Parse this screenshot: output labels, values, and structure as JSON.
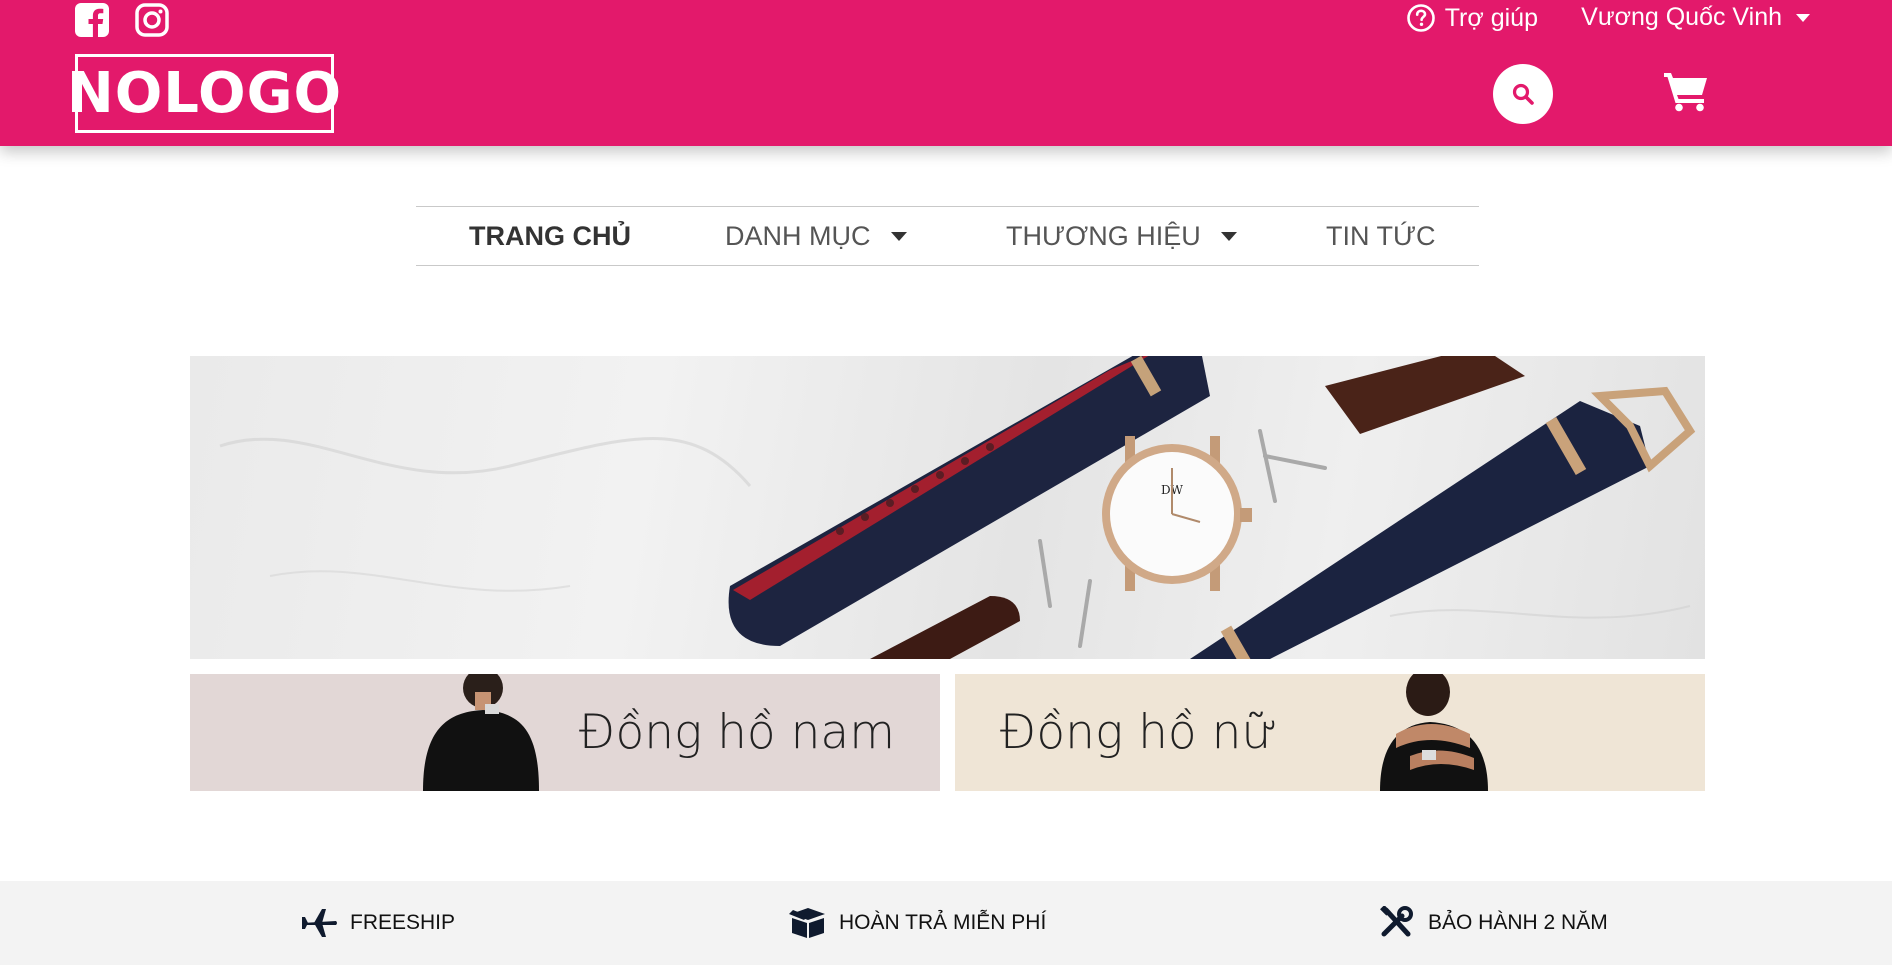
{
  "header": {
    "social": [
      {
        "icon": "facebook-square-icon"
      },
      {
        "icon": "instagram-icon"
      }
    ],
    "logo_text": "NOLOGO",
    "help_label": "Trợ giúp",
    "user_name": "Vương Quốc Vinh",
    "brand_color": "#e3196b"
  },
  "nav": {
    "items": [
      {
        "label": "TRANG CHỦ",
        "active": true,
        "dropdown": false
      },
      {
        "label": "DANH MỤC",
        "active": false,
        "dropdown": true
      },
      {
        "label": "THƯƠNG HIỆU",
        "active": false,
        "dropdown": true
      },
      {
        "label": "TIN TỨC",
        "active": false,
        "dropdown": false
      }
    ]
  },
  "hero": {
    "image": "watch-with-nato-straps-on-marble",
    "dial_text": "DW"
  },
  "categories": [
    {
      "label": "Đồng hồ nam",
      "bg": "#e2d7d6"
    },
    {
      "label": "Đồng hồ nữ",
      "bg": "#efe5d6"
    }
  ],
  "features": [
    {
      "icon": "plane-icon",
      "label": "FREESHIP"
    },
    {
      "icon": "box-icon",
      "label": "HOÀN TRẢ MIỄN PHÍ"
    },
    {
      "icon": "tools-icon",
      "label": "BẢO HÀNH 2 NĂM"
    }
  ]
}
